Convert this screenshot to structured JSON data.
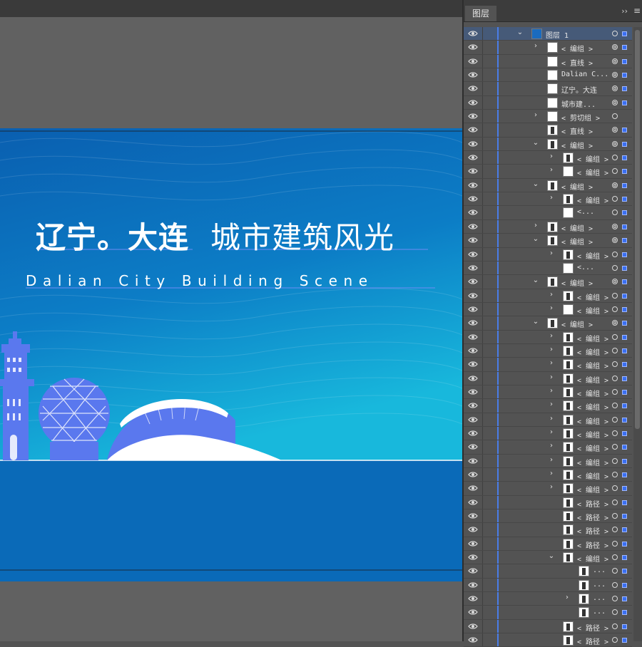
{
  "artboard": {
    "title_bold": "辽宁。大连",
    "title_light": "城市建筑风光",
    "subtitle": "Dalian City Building Scene",
    "colors": {
      "bg_top": "#0a5fb0",
      "bg_bottom": "#13b0d8",
      "skyline": "#5a78ee",
      "band": "#0a6ab8"
    }
  },
  "layers_panel": {
    "tab": "图层",
    "collapse_icon": "double-chevron-right-icon",
    "menu_icon": "hamburger-menu-icon",
    "rows": [
      {
        "name": "图层 1",
        "chev": "v",
        "indent": 0,
        "thumb": "layer",
        "target": "single",
        "sel": true,
        "selected": true
      },
      {
        "name": "< 编组 >",
        "chev": ">",
        "indent": 1,
        "thumb": "blank",
        "target": "double",
        "sel": true
      },
      {
        "name": "< 直线 >",
        "chev": "",
        "indent": 1,
        "thumb": "blank",
        "target": "double",
        "sel": true
      },
      {
        "name": "Dalian C...",
        "chev": "",
        "indent": 1,
        "thumb": "blank",
        "target": "double",
        "sel": true
      },
      {
        "name": "辽宁。大连",
        "chev": "",
        "indent": 1,
        "thumb": "blank",
        "target": "double",
        "sel": true
      },
      {
        "name": "城市建...",
        "chev": "",
        "indent": 1,
        "thumb": "blank",
        "target": "double",
        "sel": true
      },
      {
        "name": "< 剪切组 >",
        "chev": ">",
        "indent": 1,
        "thumb": "blank",
        "target": "single",
        "sel": false
      },
      {
        "name": "< 直线 >",
        "chev": "",
        "indent": 1,
        "thumb": "line",
        "target": "double",
        "sel": true
      },
      {
        "name": "< 编组 >",
        "chev": "v",
        "indent": 1,
        "thumb": "tower",
        "target": "double",
        "sel": true
      },
      {
        "name": "< 编组 >",
        "chev": ">",
        "indent": 2,
        "thumb": "tower",
        "target": "single",
        "sel": true
      },
      {
        "name": "< 编组 >",
        "chev": ">",
        "indent": 2,
        "thumb": "blank",
        "target": "single",
        "sel": true
      },
      {
        "name": "< 编组 >",
        "chev": "v",
        "indent": 1,
        "thumb": "sphere",
        "target": "double",
        "sel": true
      },
      {
        "name": "< 编组 >",
        "chev": ">",
        "indent": 2,
        "thumb": "sphere",
        "target": "single",
        "sel": true
      },
      {
        "name": "<...",
        "chev": "",
        "indent": 2,
        "thumb": "blank",
        "target": "single",
        "sel": true
      },
      {
        "name": "< 编组 >",
        "chev": ">",
        "indent": 1,
        "thumb": "arch",
        "target": "double",
        "sel": true
      },
      {
        "name": "< 编组 >",
        "chev": "v",
        "indent": 1,
        "thumb": "tower",
        "target": "double",
        "sel": true
      },
      {
        "name": "< 编组 >",
        "chev": ">",
        "indent": 2,
        "thumb": "tower",
        "target": "single",
        "sel": true
      },
      {
        "name": "<...",
        "chev": "",
        "indent": 2,
        "thumb": "blank",
        "target": "single",
        "sel": true
      },
      {
        "name": "< 编组 >",
        "chev": "v",
        "indent": 1,
        "thumb": "peak",
        "target": "double",
        "sel": true
      },
      {
        "name": "< 编组 >",
        "chev": ">",
        "indent": 2,
        "thumb": "peak",
        "target": "single",
        "sel": true
      },
      {
        "name": "< 编组 >",
        "chev": ">",
        "indent": 2,
        "thumb": "blank",
        "target": "single",
        "sel": true
      },
      {
        "name": "< 编组 >",
        "chev": "v",
        "indent": 1,
        "thumb": "bars",
        "target": "double",
        "sel": true
      },
      {
        "name": "< 编组 >",
        "chev": ">",
        "indent": 2,
        "thumb": "bars",
        "target": "single",
        "sel": true
      },
      {
        "name": "< 编组 >",
        "chev": ">",
        "indent": 2,
        "thumb": "bars",
        "target": "single",
        "sel": true
      },
      {
        "name": "< 编组 >",
        "chev": ">",
        "indent": 2,
        "thumb": "lines",
        "target": "single",
        "sel": true
      },
      {
        "name": "< 编组 >",
        "chev": ">",
        "indent": 2,
        "thumb": "lines",
        "target": "single",
        "sel": true
      },
      {
        "name": "< 编组 >",
        "chev": ">",
        "indent": 2,
        "thumb": "diamond",
        "target": "single",
        "sel": true
      },
      {
        "name": "< 编组 >",
        "chev": ">",
        "indent": 2,
        "thumb": "slash",
        "target": "single",
        "sel": true
      },
      {
        "name": "< 编组 >",
        "chev": ">",
        "indent": 2,
        "thumb": "slash",
        "target": "single",
        "sel": true
      },
      {
        "name": "< 编组 >",
        "chev": ">",
        "indent": 2,
        "thumb": "diamond",
        "target": "single",
        "sel": true
      },
      {
        "name": "< 编组 >",
        "chev": ">",
        "indent": 2,
        "thumb": "lines",
        "target": "single",
        "sel": true
      },
      {
        "name": "< 编组 >",
        "chev": ">",
        "indent": 2,
        "thumb": "curves",
        "target": "single",
        "sel": true
      },
      {
        "name": "< 编组 >",
        "chev": ">",
        "indent": 2,
        "thumb": "curves",
        "target": "single",
        "sel": true
      },
      {
        "name": "< 编组 >",
        "chev": ">",
        "indent": 2,
        "thumb": "lines",
        "target": "single",
        "sel": true
      },
      {
        "name": "< 路径 >",
        "chev": "",
        "indent": 2,
        "thumb": "bar",
        "target": "single",
        "sel": true
      },
      {
        "name": "< 路径 >",
        "chev": "",
        "indent": 2,
        "thumb": "bar",
        "target": "single",
        "sel": true
      },
      {
        "name": "< 路径 >",
        "chev": "",
        "indent": 2,
        "thumb": "bar",
        "target": "single",
        "sel": true
      },
      {
        "name": "< 路径 >",
        "chev": "",
        "indent": 2,
        "thumb": "bar",
        "target": "single",
        "sel": true
      },
      {
        "name": "< 编组 >",
        "chev": "v",
        "indent": 2,
        "thumb": "bars",
        "target": "single",
        "sel": true
      },
      {
        "name": "...",
        "chev": "",
        "indent": 3,
        "thumb": "hline",
        "target": "single",
        "sel": true
      },
      {
        "name": "...",
        "chev": "",
        "indent": 3,
        "thumb": "hline",
        "target": "single",
        "sel": true
      },
      {
        "name": "...",
        "chev": ">",
        "indent": 3,
        "thumb": "bars",
        "target": "single",
        "sel": true
      },
      {
        "name": "...",
        "chev": "",
        "indent": 3,
        "thumb": "hline",
        "target": "single",
        "sel": true
      },
      {
        "name": "< 路径 >",
        "chev": "",
        "indent": 2,
        "thumb": "hline",
        "target": "single",
        "sel": true
      },
      {
        "name": "< 路径 >",
        "chev": "",
        "indent": 2,
        "thumb": "hline",
        "target": "single",
        "sel": true
      }
    ]
  }
}
